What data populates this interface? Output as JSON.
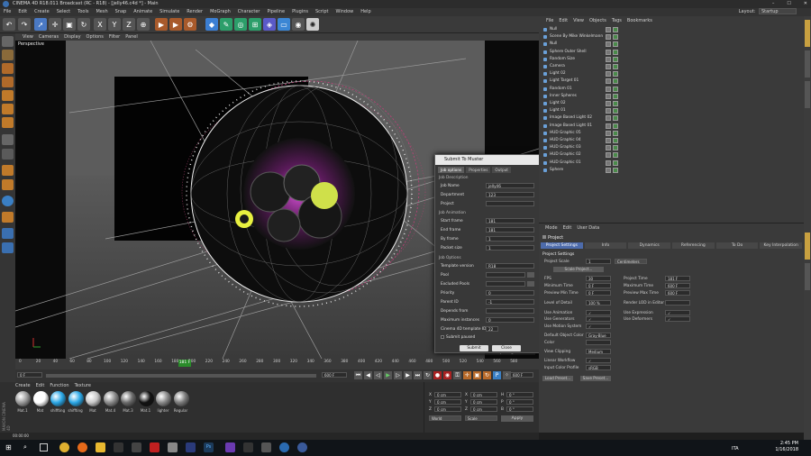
{
  "window": {
    "title": "CINEMA 4D R18.011 Broadcast (RC - R18) - [jelly46.c4d *] - Main"
  },
  "menubar": [
    "File",
    "Edit",
    "Create",
    "Select",
    "Tools",
    "Mesh",
    "Snap",
    "Animate",
    "Simulate",
    "Render",
    "MoGraph",
    "Character",
    "Pipeline",
    "Plugins",
    "Script",
    "Window",
    "Help"
  ],
  "layout": {
    "label": "Layout:",
    "value": "Startup"
  },
  "viewport": {
    "menu": [
      "View",
      "Cameras",
      "Display",
      "Options",
      "Filter",
      "Panel"
    ],
    "label": "Perspective",
    "grid_spacing": "Grid Spacing : 100 cm"
  },
  "timeline": {
    "ticks": [
      "0",
      "20",
      "40",
      "60",
      "80",
      "100",
      "120",
      "140",
      "160",
      "180",
      "200",
      "220",
      "240",
      "260",
      "280",
      "300",
      "320",
      "340",
      "360",
      "380",
      "400",
      "420",
      "440",
      "460",
      "480",
      "500",
      "520",
      "540",
      "560",
      "580"
    ],
    "current_frame": "181 F",
    "start": "0 F",
    "end": "600 F",
    "end2": "600 F",
    "frame_field": "181 F"
  },
  "materials": {
    "menu": [
      "Create",
      "Edit",
      "Function",
      "Texture"
    ],
    "items": [
      {
        "label": "Mat.1",
        "color": "#9a9a9a"
      },
      {
        "label": "Mat",
        "color": "#ffffff"
      },
      {
        "label": "shiffting",
        "color": "#2aa7e6"
      },
      {
        "label": "shiffting",
        "color": "#2aa7e6"
      },
      {
        "label": "Mat",
        "color": "#c8c8c8"
      },
      {
        "label": "Mat.4",
        "color": "#8a8a8a"
      },
      {
        "label": "Mat.3",
        "color": "#6a6a6a"
      },
      {
        "label": "Mat.1",
        "color": "#111111"
      },
      {
        "label": "lighter",
        "color": "#888888"
      },
      {
        "label": "Regular",
        "color": "#7a7a7a"
      }
    ]
  },
  "coords": {
    "rows": [
      {
        "a": "X",
        "av": "0 cm",
        "b": "X",
        "bv": "0 cm",
        "c": "H",
        "cv": "0 °"
      },
      {
        "a": "Y",
        "av": "0 cm",
        "b": "Y",
        "bv": "0 cm",
        "c": "P",
        "cv": "0 °"
      },
      {
        "a": "Z",
        "av": "0 cm",
        "b": "Z",
        "bv": "0 cm",
        "c": "B",
        "cv": "0 °"
      }
    ],
    "mode1": "World",
    "mode2": "Scale",
    "apply": "Apply"
  },
  "status": "00:00:00",
  "objects": {
    "menu": [
      "File",
      "Edit",
      "View",
      "Objects",
      "Tags",
      "Bookmarks"
    ],
    "rows": [
      "Null",
      "Scene By Mike Winkelmann",
      "Null",
      "Sphere Outer Shell",
      "Random Size",
      "Camera",
      "Light 02",
      "Light Target 01",
      "Random 01",
      "Inner Spheres",
      "Light 02",
      "Light 01",
      "Image Based Light 02",
      "Image Based Light 01",
      "HUD Graphic 05",
      "HUD Graphic 04",
      "HUD Graphic 03",
      "HUD Graphic 02",
      "HUD Graphic 01",
      "Sphere"
    ]
  },
  "attributes": {
    "menu": [
      "Mode",
      "Edit",
      "User Data"
    ],
    "header": "Project",
    "tabs": [
      "Project Settings",
      "Info",
      "Dynamics",
      "Referencing",
      "To Do",
      "Key Interpolation"
    ],
    "section": "Project Settings",
    "fields": [
      {
        "label": "Project Scale",
        "value": "1",
        "extra": "Centimeters"
      },
      {
        "label": "FPS",
        "value": "30",
        "label2": "Project Time",
        "value2": "181 F"
      },
      {
        "label": "Minimum Time",
        "value": "0 F",
        "label2": "Maximum Time",
        "value2": "600 F"
      },
      {
        "label": "Preview Min Time",
        "value": "0 F",
        "label2": "Preview Max Time",
        "value2": "600 F"
      },
      {
        "label": "Level of Detail",
        "value": "100 %",
        "label2": "Render LOD in Editor",
        "value2": ""
      },
      {
        "label": "Use Animation",
        "value": "✓",
        "label2": "Use Expression",
        "value2": "✓"
      },
      {
        "label": "Use Generators",
        "value": "✓",
        "label2": "Use Deformers",
        "value2": "✓"
      },
      {
        "label": "Use Motion System",
        "value": "✓",
        "label2": "",
        "value2": ""
      },
      {
        "label": "Default Object Color",
        "value": "Gray-Blue",
        "label2": "",
        "value2": ""
      },
      {
        "label": "Color",
        "value": "",
        "label2": "",
        "value2": ""
      },
      {
        "label": "View Clipping",
        "value": "Medium",
        "label2": "",
        "value2": ""
      },
      {
        "label": "Linear Workflow",
        "value": "✓",
        "label2": "",
        "value2": ""
      },
      {
        "label": "Input Color Profile",
        "value": "sRGB",
        "label2": "",
        "value2": ""
      }
    ],
    "scale_btn": "Scale Project...",
    "load": "Load Preset...",
    "save": "Save Preset..."
  },
  "dialog": {
    "title": "Submit To Muster",
    "tabs": [
      "Job options",
      "Properties",
      "Output"
    ],
    "sec1": "Job Description",
    "job_name_lbl": "Job Name",
    "job_name": "jelly46",
    "dept_lbl": "Department",
    "dept": "123",
    "project_lbl": "Project",
    "project": "",
    "sec2": "Job Animation",
    "start_lbl": "Start frame",
    "start": "181",
    "end_lbl": "End frame",
    "end": "181",
    "by_lbl": "By frame",
    "by": "1",
    "packet_lbl": "Packet size",
    "packet": "1",
    "sec3": "Job Options",
    "tmpl_lbl": "Template version",
    "tmpl": "R18",
    "pool_lbl": "Pool",
    "pool": "",
    "excl_lbl": "Excluded Pools",
    "excl": "",
    "prio_lbl": "Priority",
    "prio": "0",
    "parent_lbl": "Parent ID",
    "parent": "-1",
    "dep_lbl": "Depends from",
    "dep": "",
    "max_lbl": "Maximum instances",
    "max": "0",
    "c4d_lbl": "Cinema 4D template ID",
    "c4d": "22",
    "paused": "Submit paused",
    "submit": "Submit",
    "close": "Close"
  },
  "taskbar": {
    "time": "2:45 PM",
    "date": "1/16/2018",
    "lang": "ITA"
  }
}
